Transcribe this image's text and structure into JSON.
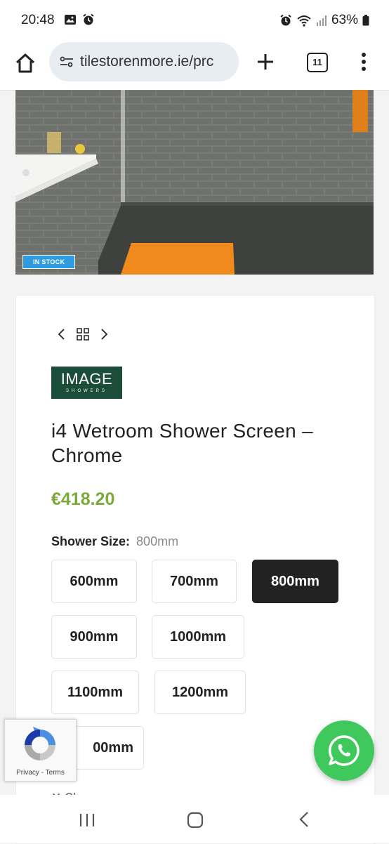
{
  "status_bar": {
    "time": "20:48",
    "battery": "63%",
    "icons": [
      "gallery-icon",
      "alarm-icon",
      "alarm-icon",
      "wifi-icon",
      "signal-icon",
      "battery-icon"
    ]
  },
  "browser": {
    "url": "tilestorenmore.ie/prc",
    "tab_count": "11",
    "icons": [
      "home-icon",
      "site-settings-icon",
      "plus-icon",
      "tabs-icon",
      "menu-icon"
    ]
  },
  "product": {
    "stock_badge": "IN STOCK",
    "brand_main": "IMAGE",
    "brand_sub": "SHOWERS",
    "title": "i4 Wetroom Shower Screen – Chrome",
    "price": "€418.20",
    "size_label": "Shower Size:",
    "size_selected": "800mm",
    "sizes": [
      "600mm",
      "700mm",
      "800mm",
      "900mm",
      "1000mm",
      "1100mm",
      "1200mm",
      "1400mm"
    ],
    "size_partial_visible": "00mm",
    "clear_label": "✕ Clear"
  },
  "recaptcha": {
    "text": "Privacy - Terms"
  },
  "colors": {
    "price": "#7aab3a",
    "stock_badge": "#2f9be0",
    "brand_logo": "#1c4d3b",
    "whatsapp": "#3fc85c",
    "selected_size": "#222222"
  }
}
